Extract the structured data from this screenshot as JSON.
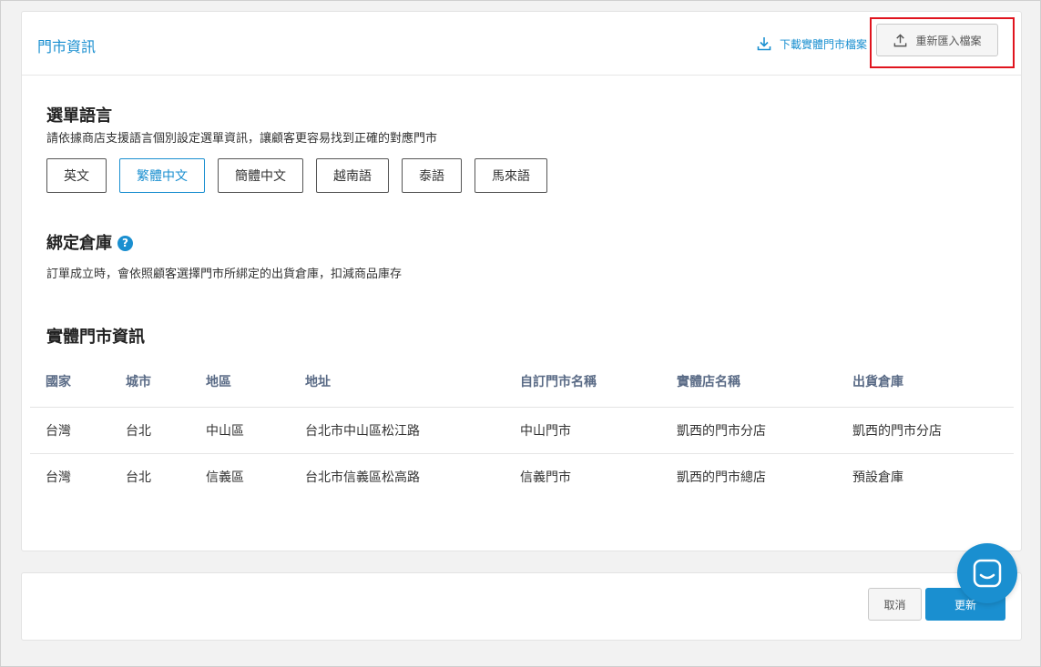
{
  "header": {
    "title": "門市資訊",
    "download_label": "下載實體門市檔案",
    "reimport_label": "重新匯入檔案"
  },
  "menu_language": {
    "title": "選單語言",
    "description": "請依據商店支援語言個別設定選單資訊，讓顧客更容易找到正確的對應門市",
    "options": [
      "英文",
      "繁體中文",
      "簡體中文",
      "越南語",
      "泰語",
      "馬來語"
    ],
    "selected": "繁體中文"
  },
  "warehouse": {
    "title": "綁定倉庫",
    "help_glyph": "?",
    "description": "訂單成立時，會依照顧客選擇門市所綁定的出貨倉庫，扣減商品庫存"
  },
  "stores": {
    "title": "實體門市資訊",
    "columns": [
      "國家",
      "城市",
      "地區",
      "地址",
      "自訂門市名稱",
      "實體店名稱",
      "出貨倉庫"
    ],
    "rows": [
      [
        "台灣",
        "台北",
        "中山區",
        "台北市中山區松江路",
        "中山門市",
        "凱西的門市分店",
        "凱西的門市分店"
      ],
      [
        "台灣",
        "台北",
        "信義區",
        "台北市信義區松高路",
        "信義門市",
        "凱西的門市總店",
        "預設倉庫"
      ]
    ]
  },
  "footer": {
    "cancel_label": "取消",
    "update_label": "更新"
  },
  "colors": {
    "accent": "#1a8fd0",
    "highlight_box": "#e0141e"
  },
  "icons": {
    "download": "download-icon",
    "upload": "upload-icon",
    "help": "help-circle-icon",
    "chat": "chat-icon"
  }
}
